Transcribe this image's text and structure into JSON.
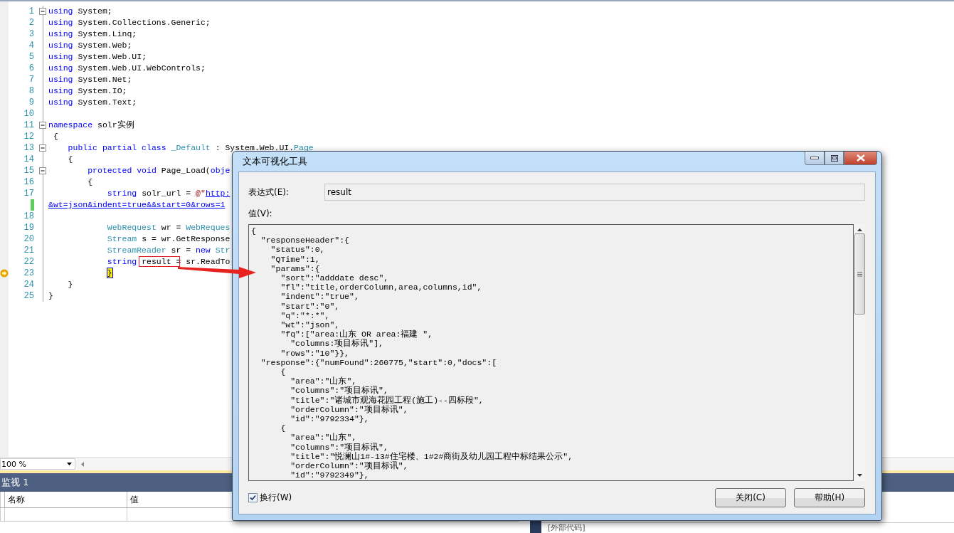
{
  "editor": {
    "lines": [
      {
        "number": "1",
        "fold": true,
        "tokens": [
          {
            "kind": "keyword",
            "text": "using"
          },
          {
            "kind": "plain",
            "text": " System;"
          }
        ]
      },
      {
        "number": "2",
        "fold": false,
        "tokens": [
          {
            "kind": "keyword",
            "text": "using"
          },
          {
            "kind": "plain",
            "text": " System.Collections.Generic;"
          }
        ]
      },
      {
        "number": "3",
        "fold": false,
        "tokens": [
          {
            "kind": "keyword",
            "text": "using"
          },
          {
            "kind": "plain",
            "text": " System.Linq;"
          }
        ]
      },
      {
        "number": "4",
        "fold": false,
        "tokens": [
          {
            "kind": "keyword",
            "text": "using"
          },
          {
            "kind": "plain",
            "text": " System.Web;"
          }
        ]
      },
      {
        "number": "5",
        "fold": false,
        "tokens": [
          {
            "kind": "keyword",
            "text": "using"
          },
          {
            "kind": "plain",
            "text": " System.Web.UI;"
          }
        ]
      },
      {
        "number": "6",
        "fold": false,
        "tokens": [
          {
            "kind": "keyword",
            "text": "using"
          },
          {
            "kind": "plain",
            "text": " System.Web.UI.WebControls;"
          }
        ]
      },
      {
        "number": "7",
        "fold": false,
        "tokens": [
          {
            "kind": "keyword",
            "text": "using"
          },
          {
            "kind": "plain",
            "text": " System.Net;"
          }
        ]
      },
      {
        "number": "8",
        "fold": false,
        "tokens": [
          {
            "kind": "keyword",
            "text": "using"
          },
          {
            "kind": "plain",
            "text": " System.IO;"
          }
        ]
      },
      {
        "number": "9",
        "fold": false,
        "tokens": [
          {
            "kind": "keyword",
            "text": "using"
          },
          {
            "kind": "plain",
            "text": " System.Text;"
          }
        ]
      },
      {
        "number": "10",
        "fold": false
      },
      {
        "number": "11",
        "fold": true,
        "tokens": [
          {
            "kind": "keyword",
            "text": "namespace"
          },
          {
            "kind": "plain",
            "text": " solr实例"
          }
        ]
      },
      {
        "number": "12",
        "fold": false,
        "tokens": [
          {
            "kind": "plain",
            "text": " {"
          }
        ]
      },
      {
        "number": "13",
        "fold": true,
        "tokens": [
          {
            "kind": "keyword",
            "text": "    public partial class"
          },
          {
            "kind": "type",
            "text": " _Default"
          },
          {
            "kind": "plain",
            "text": " : System.Web.UI."
          },
          {
            "kind": "type",
            "text": "Page"
          }
        ]
      },
      {
        "number": "14",
        "fold": false,
        "tokens": [
          {
            "kind": "plain",
            "text": "    {"
          }
        ]
      },
      {
        "number": "15",
        "fold": true,
        "tokens": [
          {
            "kind": "keyword",
            "text": "        protected void"
          },
          {
            "kind": "plain",
            "text": " Page_Load("
          },
          {
            "kind": "keyword",
            "text": "obje"
          }
        ]
      },
      {
        "number": "16",
        "fold": false,
        "tokens": [
          {
            "kind": "plain",
            "text": "        {"
          }
        ]
      },
      {
        "number": "17",
        "fold": false,
        "tokens": [
          {
            "kind": "keyword",
            "text": "            string"
          },
          {
            "kind": "plain",
            "text": " solr_url = "
          },
          {
            "kind": "string",
            "text": "@\""
          },
          {
            "kind": "link",
            "text": "http:"
          }
        ]
      },
      {
        "kind": "wrap",
        "fold": false,
        "tokens": [
          {
            "kind": "link",
            "text": "&wt=json&indent=true&&start=0&rows=1"
          }
        ]
      },
      {
        "number": "18",
        "fold": false
      },
      {
        "number": "19",
        "fold": false,
        "tokens": [
          {
            "kind": "type",
            "text": "            WebRequest"
          },
          {
            "kind": "plain",
            "text": " wr = "
          },
          {
            "kind": "type",
            "text": "WebReques"
          }
        ]
      },
      {
        "number": "20",
        "fold": false,
        "tokens": [
          {
            "kind": "type",
            "text": "            Stream"
          },
          {
            "kind": "plain",
            "text": " s = wr.GetResponse"
          }
        ]
      },
      {
        "number": "21",
        "fold": false,
        "tokens": [
          {
            "kind": "type",
            "text": "            StreamReader"
          },
          {
            "kind": "plain",
            "text": " sr = "
          },
          {
            "kind": "keyword",
            "text": "new"
          },
          {
            "kind": "type",
            "text": " Str"
          }
        ]
      },
      {
        "number": "22",
        "fold": false,
        "tokens": [
          {
            "kind": "keyword",
            "text": "            string "
          },
          {
            "kind": "plain",
            "boxed": true,
            "text": "result"
          },
          {
            "kind": "plain",
            "text": " = sr.ReadTo"
          }
        ]
      },
      {
        "number": "23",
        "fold": false,
        "current": true,
        "tokens": [
          {
            "kind": "current",
            "text": "            }"
          }
        ]
      },
      {
        "number": "24",
        "fold": false,
        "tokens": [
          {
            "kind": "plain",
            "text": "    }"
          }
        ]
      },
      {
        "number": "25",
        "fold": false,
        "tokens": [
          {
            "kind": "plain",
            "text": "}"
          }
        ]
      }
    ]
  },
  "zoom": {
    "value": "100 %"
  },
  "watch": {
    "title": "监视 1",
    "columns": [
      "名称",
      "值"
    ]
  },
  "call_stack": {
    "rows": [
      "[外部代码]"
    ]
  },
  "dialog": {
    "title": "文本可视化工具",
    "expression_label": "表达式(E):",
    "expression_value": "result",
    "value_label": "值(V):",
    "value_lines": [
      "{",
      "  \"responseHeader\":{",
      "    \"status\":0,",
      "    \"QTime\":1,",
      "    \"params\":{",
      "      \"sort\":\"adddate desc\",",
      "      \"fl\":\"title,orderColumn,area,columns,id\",",
      "      \"indent\":\"true\",",
      "      \"start\":\"0\",",
      "      \"q\":\"*:*\",",
      "      \"wt\":\"json\",",
      "      \"fq\":[\"area:山东 OR area:福建 \",",
      "        \"columns:项目标讯\"],",
      "      \"rows\":\"10\"}},",
      "  \"response\":{\"numFound\":260775,\"start\":0,\"docs\":[",
      "      {",
      "        \"area\":\"山东\",",
      "        \"columns\":\"项目标讯\",",
      "        \"title\":\"诸城市观海花园工程(施工)--四标段\",",
      "        \"orderColumn\":\"项目标讯\",",
      "        \"id\":\"9792334\"},",
      "      {",
      "        \"area\":\"山东\",",
      "        \"columns\":\"项目标讯\",",
      "        \"title\":\"悦澜山1#-13#住宅楼、1#2#商街及幼儿园工程中标结果公示\",",
      "        \"orderColumn\":\"项目标讯\",",
      "        \"id\":\"9792349\"},"
    ],
    "word_wrap": {
      "label": "换行(W)",
      "checked": true
    },
    "buttons": [
      "关闭(C)",
      "帮助(H)"
    ]
  }
}
